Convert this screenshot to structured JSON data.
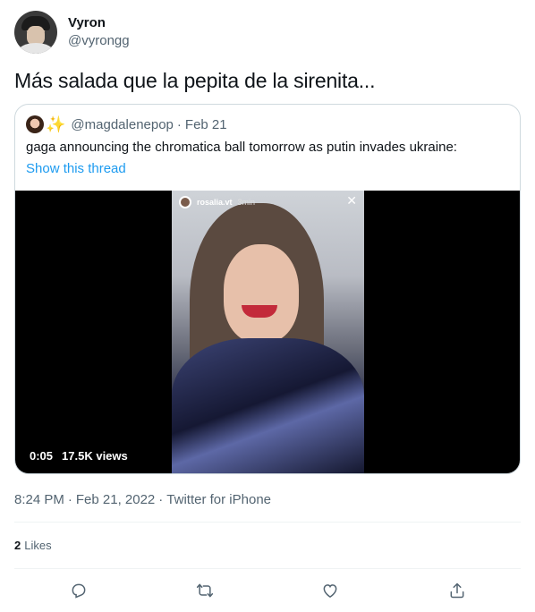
{
  "author": {
    "display_name": "Vyron",
    "handle": "@vyrongg"
  },
  "tweet": {
    "text": "Más salada que la pepita de la sirenita...",
    "time": "8:24 PM",
    "date": "Feb 21, 2022",
    "source": "Twitter for iPhone",
    "separator": "·"
  },
  "quote": {
    "handle": "@magdalenepop",
    "separator": "·",
    "date": "Feb 21",
    "text": "gaga announcing the chromatica ball tomorrow as putin invades ukraine:",
    "show_thread": "Show this thread",
    "video": {
      "story_user": "rosalia.vt",
      "story_time": "3min",
      "duration": "0:05",
      "views": "17.5K views"
    }
  },
  "likes": {
    "count": "2",
    "label": "Likes"
  },
  "actions": {
    "reply_icon": "reply-icon",
    "retweet_icon": "retweet-icon",
    "like_icon": "like-icon",
    "share_icon": "share-icon"
  },
  "colors": {
    "link": "#1d9bf0",
    "secondary_text": "#536471",
    "border": "#cfd9de"
  }
}
